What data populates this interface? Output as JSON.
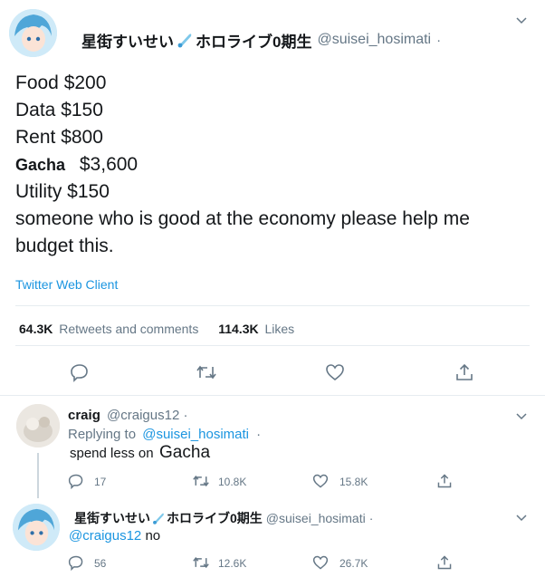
{
  "main_tweet": {
    "display_name": "星街すいせい",
    "display_name_suffix": "ホロライブ0期生",
    "handle": "@suisei_hosimati",
    "dot": "·",
    "lines": [
      "Food $200",
      "Data $150",
      "Rent $800",
      "Gacha",
      "$3,600",
      "Utility $150",
      "someone who is good at the economy please help me",
      "budget this."
    ],
    "source": "Twitter Web Client",
    "stats": {
      "retweets_value": "64.3K",
      "retweets_label": "Retweets and comments",
      "likes_value": "114.3K",
      "likes_label": "Likes"
    }
  },
  "reply1": {
    "display_name": "craig",
    "handle": "@craigus12",
    "dot": "·",
    "replying_prefix": "Replying to",
    "replying_handle": "@suisei_hosimati",
    "text_prefix": "spend less on",
    "text_emphasis": "Gacha",
    "counts": {
      "replies": "17",
      "retweets": "10.8K",
      "likes": "15.8K"
    }
  },
  "reply2": {
    "display_name": "星街すいせい",
    "display_name_suffix": "ホロライブ0期生",
    "handle": "@suisei_hosimati",
    "dot": "·",
    "mention": "@craigus12",
    "text": "no",
    "counts": {
      "replies": "56",
      "retweets": "12.6K",
      "likes": "26.7K"
    }
  },
  "colors": {
    "link": "#1b95e0",
    "muted": "#657786",
    "border": "#e6ecf0",
    "avatar_bg": "#bfe3f5"
  },
  "icons": [
    "chevron-down-icon",
    "comet-icon",
    "reply-icon",
    "retweet-icon",
    "like-icon",
    "share-icon"
  ]
}
